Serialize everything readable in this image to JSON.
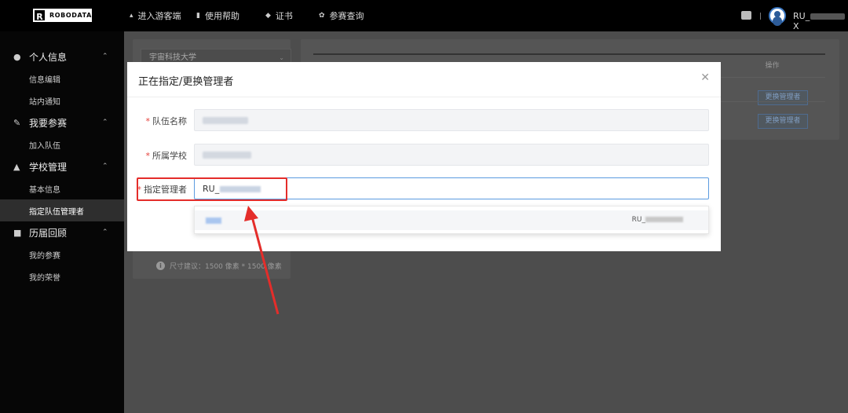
{
  "topbar": {
    "logo_letter": "R",
    "logo_text": "ROBODATA",
    "nav": [
      {
        "icon": "shoe-icon",
        "label": "进入游客端"
      },
      {
        "icon": "book-icon",
        "label": "使用帮助"
      },
      {
        "icon": "cert-icon",
        "label": "证书"
      },
      {
        "icon": "gear-icon",
        "label": "参赛查询"
      }
    ],
    "username_prefix": "RU_",
    "username_suffix": "X"
  },
  "sidebar": {
    "sections": [
      {
        "icon": "user-icon",
        "label": "个人信息",
        "items": [
          "信息编辑",
          "站内通知"
        ]
      },
      {
        "icon": "flag-icon",
        "label": "我要参赛",
        "items": [
          "加入队伍"
        ]
      },
      {
        "icon": "school-icon",
        "label": "学校管理",
        "items": [
          "基本信息",
          "指定队伍管理者"
        ]
      },
      {
        "icon": "cube-icon",
        "label": "历届回顾",
        "items": [
          "我的参赛",
          "我的荣誉"
        ]
      }
    ],
    "active_item": "指定队伍管理者"
  },
  "background": {
    "school_select": "宇宙科技大学",
    "size_hint": "尺寸建议：1500 像素 * 1500 像素",
    "table_header_action": "操作",
    "row_button_label": "更换管理者"
  },
  "modal": {
    "title": "正在指定/更换管理者",
    "fields": {
      "team_name_label": "队伍名称",
      "school_label": "所属学校",
      "manager_label": "指定管理者",
      "manager_value_prefix": "RU_"
    },
    "dropdown_option_id_prefix": "RU_"
  },
  "colors": {
    "accent_red": "#e42d2a",
    "focus_blue": "#5b9be0",
    "required_star": "#e5403a"
  }
}
